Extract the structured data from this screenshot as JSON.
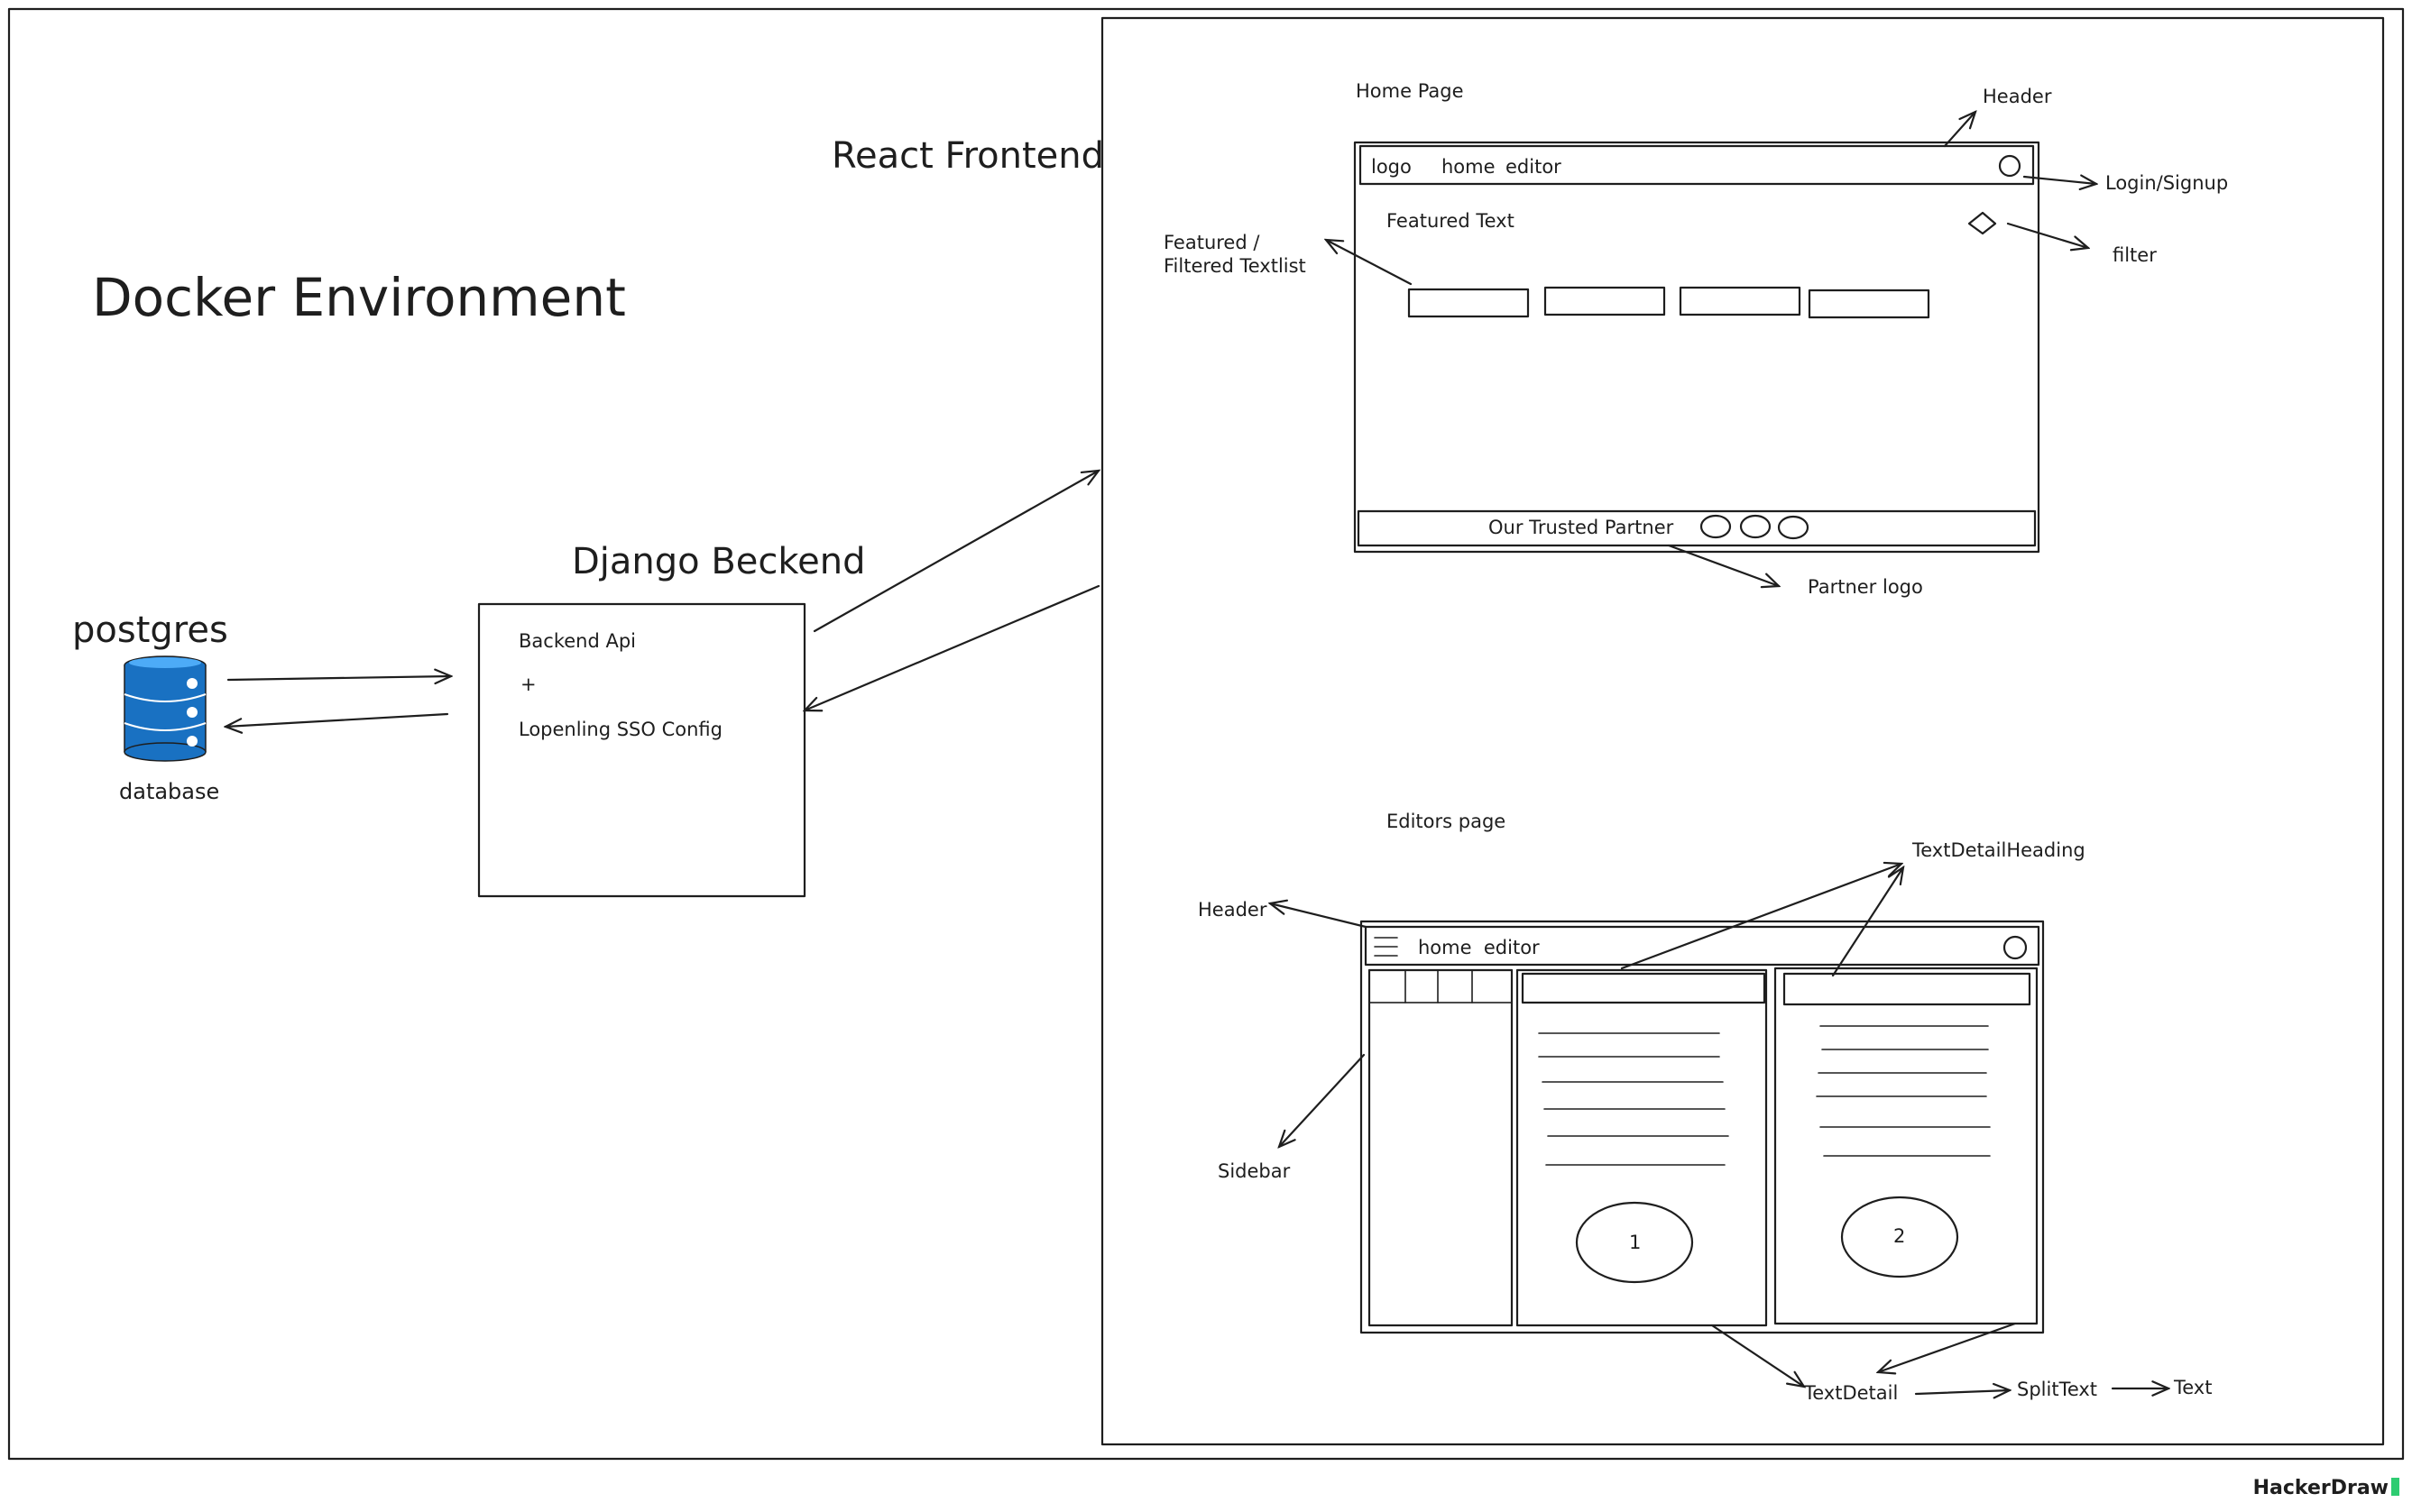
{
  "diagram": {
    "docker_title": "Docker Environment",
    "react_title": "React Frontend",
    "django_title": "Django Beckend",
    "postgres_title": "postgres",
    "database_label": "database",
    "backend_box": {
      "line1": "Backend Api",
      "line2": "+",
      "line3": "Lopenling SSO Config"
    },
    "home_page": {
      "title": "Home Page",
      "nav_logo": "logo",
      "nav_home": "home",
      "nav_editor": "editor",
      "featured_text": "Featured Text",
      "footer_text": "Our Trusted Partner"
    },
    "home_annotations": {
      "header": "Header",
      "login": "Login/Signup",
      "filter": "filter",
      "textlist_line1": "Featured /",
      "textlist_line2": "Filtered Textlist",
      "partner_logo": "Partner logo"
    },
    "editors_page": {
      "title": "Editors page",
      "nav_home_editor": "home  editor",
      "panel1_number": "1",
      "panel2_number": "2"
    },
    "editor_annotations": {
      "header": "Header",
      "sidebar": "Sidebar",
      "heading": "TextDetailHeading",
      "text_detail": "TextDetail",
      "split_text": "SplitText",
      "text": "Text"
    }
  },
  "colors": {
    "ink": "#1e1e1e",
    "db_fill": "#1971c2",
    "db_light": "#4dabf7",
    "brand_accent": "#2ecc71"
  },
  "branding": {
    "name": "HackerDraw"
  }
}
